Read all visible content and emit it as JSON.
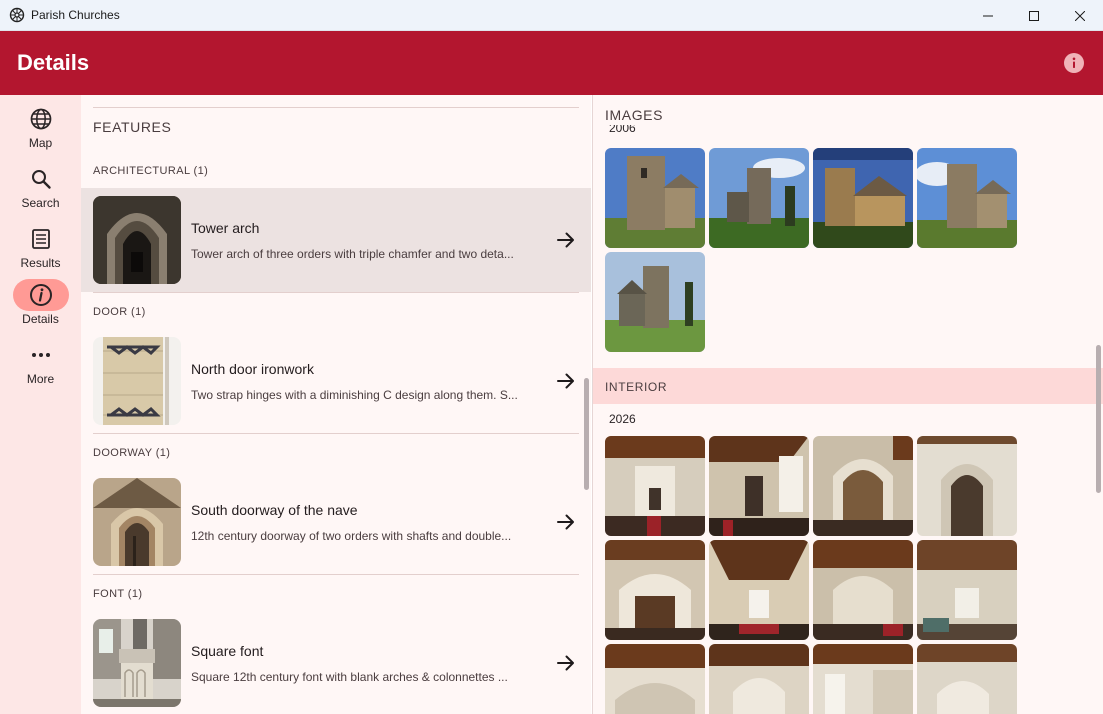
{
  "window": {
    "title": "Parish Churches"
  },
  "appbar": {
    "title": "Details"
  },
  "rail": [
    {
      "label": "Map",
      "icon": "globe-icon",
      "active": false
    },
    {
      "label": "Search",
      "icon": "search-icon",
      "active": false
    },
    {
      "label": "Results",
      "icon": "list-icon",
      "active": false
    },
    {
      "label": "Details",
      "icon": "info-icon",
      "active": true
    },
    {
      "label": "More",
      "icon": "more-icon",
      "active": false
    }
  ],
  "features": {
    "title": "FEATURES",
    "groups": [
      {
        "category": "ARCHITECTURAL (1)",
        "title": "Tower arch",
        "subtitle": "Tower arch of three orders with triple chamfer and two deta...",
        "selected": true
      },
      {
        "category": "DOOR (1)",
        "title": "North door ironwork",
        "subtitle": "Two strap hinges with a diminishing C design along them. S...",
        "selected": false
      },
      {
        "category": "DOORWAY (1)",
        "title": "South doorway of the nave",
        "subtitle": "12th century doorway of two orders with shafts and double...",
        "selected": false
      },
      {
        "category": "FONT (1)",
        "title": "Square font",
        "subtitle": "Square 12th century font with blank arches & colonnettes ...",
        "selected": false
      }
    ]
  },
  "images": {
    "title": "IMAGES",
    "exterior": {
      "year": "2006",
      "count": 5
    },
    "interior": {
      "label": "INTERIOR",
      "year": "2026",
      "count": 12
    }
  },
  "colors": {
    "brand": "#b3162f",
    "rail_bg": "#fde7e6",
    "active_indicator": "#ff9a95",
    "interior_band": "#fdd9d8"
  }
}
